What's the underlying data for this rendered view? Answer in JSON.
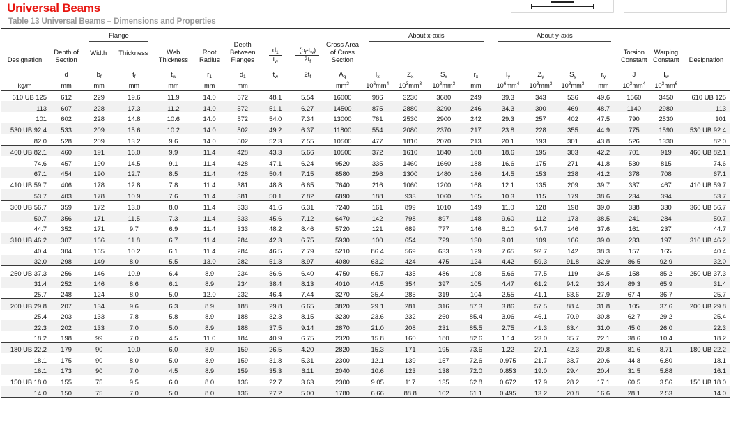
{
  "page": {
    "title": "Universal Beams",
    "caption": "Table 13 Universal Beams – Dimensions and Properties",
    "title_color": "#e8150f",
    "caption_color": "#9a9a9a"
  },
  "figures": [
    {
      "name": "beam-section-figure-1"
    },
    {
      "name": "beam-section-figure-2"
    }
  ],
  "header": {
    "groups": [
      {
        "label": "Flange",
        "span": 2
      },
      {
        "label": "About x-axis",
        "span": 4
      },
      {
        "label": "About y-axis",
        "span": 4
      }
    ],
    "columns": [
      {
        "title": "Designation",
        "symbol": "",
        "unit": "kg/m"
      },
      {
        "title": "Depth of Section",
        "symbol": "d",
        "unit": "mm"
      },
      {
        "title": "Width",
        "symbol": "b_f",
        "unit": "mm"
      },
      {
        "title": "Thickness",
        "symbol": "t_f",
        "unit": "mm"
      },
      {
        "title": "Web Thickness",
        "symbol": "t_w",
        "unit": "mm"
      },
      {
        "title": "Root Radius",
        "symbol": "r_1",
        "unit": "mm"
      },
      {
        "title": "Depth Between Flanges",
        "symbol": "d_1",
        "unit": "mm"
      },
      {
        "title": "d_1 / t_w",
        "symbol": "d1/tw",
        "unit": ""
      },
      {
        "title": "(b_f - t_w) / 2t_f",
        "symbol": "bf-tw/2tf",
        "unit": ""
      },
      {
        "title": "Gross Area of Cross Section",
        "symbol": "A_g",
        "unit": "mm2"
      },
      {
        "title": "",
        "symbol": "I_x",
        "unit": "10^6 mm^4"
      },
      {
        "title": "",
        "symbol": "Z_x",
        "unit": "10^3 mm^3"
      },
      {
        "title": "",
        "symbol": "S_x",
        "unit": "10^3 mm^3"
      },
      {
        "title": "",
        "symbol": "r_x",
        "unit": "mm"
      },
      {
        "title": "",
        "symbol": "I_y",
        "unit": "10^6 mm^4"
      },
      {
        "title": "",
        "symbol": "Z_y",
        "unit": "10^3 mm^3"
      },
      {
        "title": "",
        "symbol": "S_y",
        "unit": "10^3 mm^3"
      },
      {
        "title": "",
        "symbol": "r_y",
        "unit": "mm"
      },
      {
        "title": "Torsion Constant",
        "symbol": "J",
        "unit": "10^3 mm^4"
      },
      {
        "title": "Warping Constant",
        "symbol": "I_w",
        "unit": "10^3 mm^6"
      },
      {
        "title": "Designation",
        "symbol": "",
        "unit": ""
      }
    ],
    "labels": {
      "designation": "Designation",
      "depth_of_section": "Depth of Section",
      "flange": "Flange",
      "width": "Width",
      "thickness": "Thickness",
      "web_thickness": "Web Thickness",
      "root_radius": "Root Radius",
      "depth_between_flanges": "Depth Between Flanges",
      "gross_area": "Gross Area of Cross Section",
      "about_x": "About x-axis",
      "about_y": "About y-axis",
      "torsion_constant": "Torsion Constant",
      "warping_constant": "Warping Constant"
    }
  },
  "rows": [
    {
      "group": 1,
      "first": true,
      "alt": false,
      "c": [
        "610 UB 125",
        "612",
        "229",
        "19.6",
        "11.9",
        "14.0",
        "572",
        "48.1",
        "5.54",
        "16000",
        "986",
        "3230",
        "3680",
        "249",
        "39.3",
        "343",
        "536",
        "49.6",
        "1560",
        "3450",
        "610 UB 125"
      ]
    },
    {
      "group": 1,
      "first": false,
      "alt": true,
      "c": [
        "113",
        "607",
        "228",
        "17.3",
        "11.2",
        "14.0",
        "572",
        "51.1",
        "6.27",
        "14500",
        "875",
        "2880",
        "3290",
        "246",
        "34.3",
        "300",
        "469",
        "48.7",
        "1140",
        "2980",
        "113"
      ]
    },
    {
      "group": 1,
      "first": false,
      "alt": false,
      "c": [
        "101",
        "602",
        "228",
        "14.8",
        "10.6",
        "14.0",
        "572",
        "54.0",
        "7.34",
        "13000",
        "761",
        "2530",
        "2900",
        "242",
        "29.3",
        "257",
        "402",
        "47.5",
        "790",
        "2530",
        "101"
      ]
    },
    {
      "group": 2,
      "first": true,
      "alt": true,
      "c": [
        "530 UB 92.4",
        "533",
        "209",
        "15.6",
        "10.2",
        "14.0",
        "502",
        "49.2",
        "6.37",
        "11800",
        "554",
        "2080",
        "2370",
        "217",
        "23.8",
        "228",
        "355",
        "44.9",
        "775",
        "1590",
        "530 UB 92.4"
      ]
    },
    {
      "group": 2,
      "first": false,
      "alt": false,
      "c": [
        "82.0",
        "528",
        "209",
        "13.2",
        "9.6",
        "14.0",
        "502",
        "52.3",
        "7.55",
        "10500",
        "477",
        "1810",
        "2070",
        "213",
        "20.1",
        "193",
        "301",
        "43.8",
        "526",
        "1330",
        "82.0"
      ]
    },
    {
      "group": 3,
      "first": true,
      "alt": true,
      "c": [
        "460 UB 82.1",
        "460",
        "191",
        "16.0",
        "9.9",
        "11.4",
        "428",
        "43.3",
        "5.66",
        "10500",
        "372",
        "1610",
        "1840",
        "188",
        "18.6",
        "195",
        "303",
        "42.2",
        "701",
        "919",
        "460 UB 82.1"
      ]
    },
    {
      "group": 3,
      "first": false,
      "alt": false,
      "c": [
        "74.6",
        "457",
        "190",
        "14.5",
        "9.1",
        "11.4",
        "428",
        "47.1",
        "6.24",
        "9520",
        "335",
        "1460",
        "1660",
        "188",
        "16.6",
        "175",
        "271",
        "41.8",
        "530",
        "815",
        "74.6"
      ]
    },
    {
      "group": 3,
      "first": false,
      "alt": true,
      "c": [
        "67.1",
        "454",
        "190",
        "12.7",
        "8.5",
        "11.4",
        "428",
        "50.4",
        "7.15",
        "8580",
        "296",
        "1300",
        "1480",
        "186",
        "14.5",
        "153",
        "238",
        "41.2",
        "378",
        "708",
        "67.1"
      ]
    },
    {
      "group": 4,
      "first": true,
      "alt": false,
      "c": [
        "410 UB 59.7",
        "406",
        "178",
        "12.8",
        "7.8",
        "11.4",
        "381",
        "48.8",
        "6.65",
        "7640",
        "216",
        "1060",
        "1200",
        "168",
        "12.1",
        "135",
        "209",
        "39.7",
        "337",
        "467",
        "410 UB 59.7"
      ]
    },
    {
      "group": 4,
      "first": false,
      "alt": true,
      "c": [
        "53.7",
        "403",
        "178",
        "10.9",
        "7.6",
        "11.4",
        "381",
        "50.1",
        "7.82",
        "6890",
        "188",
        "933",
        "1060",
        "165",
        "10.3",
        "115",
        "179",
        "38.6",
        "234",
        "394",
        "53.7"
      ]
    },
    {
      "group": 5,
      "first": true,
      "alt": false,
      "c": [
        "360 UB 56.7",
        "359",
        "172",
        "13.0",
        "8.0",
        "11.4",
        "333",
        "41.6",
        "6.31",
        "7240",
        "161",
        "899",
        "1010",
        "149",
        "11.0",
        "128",
        "198",
        "39.0",
        "338",
        "330",
        "360 UB 56.7"
      ]
    },
    {
      "group": 5,
      "first": false,
      "alt": true,
      "c": [
        "50.7",
        "356",
        "171",
        "11.5",
        "7.3",
        "11.4",
        "333",
        "45.6",
        "7.12",
        "6470",
        "142",
        "798",
        "897",
        "148",
        "9.60",
        "112",
        "173",
        "38.5",
        "241",
        "284",
        "50.7"
      ]
    },
    {
      "group": 5,
      "first": false,
      "alt": false,
      "c": [
        "44.7",
        "352",
        "171",
        "9.7",
        "6.9",
        "11.4",
        "333",
        "48.2",
        "8.46",
        "5720",
        "121",
        "689",
        "777",
        "146",
        "8.10",
        "94.7",
        "146",
        "37.6",
        "161",
        "237",
        "44.7"
      ]
    },
    {
      "group": 6,
      "first": true,
      "alt": true,
      "c": [
        "310 UB 46.2",
        "307",
        "166",
        "11.8",
        "6.7",
        "11.4",
        "284",
        "42.3",
        "6.75",
        "5930",
        "100",
        "654",
        "729",
        "130",
        "9.01",
        "109",
        "166",
        "39.0",
        "233",
        "197",
        "310 UB 46.2"
      ]
    },
    {
      "group": 6,
      "first": false,
      "alt": false,
      "c": [
        "40.4",
        "304",
        "165",
        "10.2",
        "6.1",
        "11.4",
        "284",
        "46.5",
        "7.79",
        "5210",
        "86.4",
        "569",
        "633",
        "129",
        "7.65",
        "92.7",
        "142",
        "38.3",
        "157",
        "165",
        "40.4"
      ]
    },
    {
      "group": 6,
      "first": false,
      "alt": true,
      "c": [
        "32.0",
        "298",
        "149",
        "8.0",
        "5.5",
        "13.0",
        "282",
        "51.3",
        "8.97",
        "4080",
        "63.2",
        "424",
        "475",
        "124",
        "4.42",
        "59.3",
        "91.8",
        "32.9",
        "86.5",
        "92.9",
        "32.0"
      ]
    },
    {
      "group": 7,
      "first": true,
      "alt": false,
      "c": [
        "250 UB 37.3",
        "256",
        "146",
        "10.9",
        "6.4",
        "8.9",
        "234",
        "36.6",
        "6.40",
        "4750",
        "55.7",
        "435",
        "486",
        "108",
        "5.66",
        "77.5",
        "119",
        "34.5",
        "158",
        "85.2",
        "250 UB 37.3"
      ]
    },
    {
      "group": 7,
      "first": false,
      "alt": true,
      "c": [
        "31.4",
        "252",
        "146",
        "8.6",
        "6.1",
        "8.9",
        "234",
        "38.4",
        "8.13",
        "4010",
        "44.5",
        "354",
        "397",
        "105",
        "4.47",
        "61.2",
        "94.2",
        "33.4",
        "89.3",
        "65.9",
        "31.4"
      ]
    },
    {
      "group": 7,
      "first": false,
      "alt": false,
      "c": [
        "25.7",
        "248",
        "124",
        "8.0",
        "5.0",
        "12.0",
        "232",
        "46.4",
        "7.44",
        "3270",
        "35.4",
        "285",
        "319",
        "104",
        "2.55",
        "41.1",
        "63.6",
        "27.9",
        "67.4",
        "36.7",
        "25.7"
      ]
    },
    {
      "group": 8,
      "first": true,
      "alt": true,
      "c": [
        "200 UB 29.8",
        "207",
        "134",
        "9.6",
        "6.3",
        "8.9",
        "188",
        "29.8",
        "6.65",
        "3820",
        "29.1",
        "281",
        "316",
        "87.3",
        "3.86",
        "57.5",
        "88.4",
        "31.8",
        "105",
        "37.6",
        "200 UB 29.8"
      ]
    },
    {
      "group": 8,
      "first": false,
      "alt": false,
      "c": [
        "25.4",
        "203",
        "133",
        "7.8",
        "5.8",
        "8.9",
        "188",
        "32.3",
        "8.15",
        "3230",
        "23.6",
        "232",
        "260",
        "85.4",
        "3.06",
        "46.1",
        "70.9",
        "30.8",
        "62.7",
        "29.2",
        "25.4"
      ]
    },
    {
      "group": 8,
      "first": false,
      "alt": true,
      "c": [
        "22.3",
        "202",
        "133",
        "7.0",
        "5.0",
        "8.9",
        "188",
        "37.5",
        "9.14",
        "2870",
        "21.0",
        "208",
        "231",
        "85.5",
        "2.75",
        "41.3",
        "63.4",
        "31.0",
        "45.0",
        "26.0",
        "22.3"
      ]
    },
    {
      "group": 8,
      "first": false,
      "alt": false,
      "c": [
        "18.2",
        "198",
        "99",
        "7.0",
        "4.5",
        "11.0",
        "184",
        "40.9",
        "6.75",
        "2320",
        "15.8",
        "160",
        "180",
        "82.6",
        "1.14",
        "23.0",
        "35.7",
        "22.1",
        "38.6",
        "10.4",
        "18.2"
      ]
    },
    {
      "group": 9,
      "first": true,
      "alt": true,
      "c": [
        "180 UB 22.2",
        "179",
        "90",
        "10.0",
        "6.0",
        "8.9",
        "159",
        "26.5",
        "4.20",
        "2820",
        "15.3",
        "171",
        "195",
        "73.6",
        "1.22",
        "27.1",
        "42.3",
        "20.8",
        "81.6",
        "8.71",
        "180 UB 22.2"
      ]
    },
    {
      "group": 9,
      "first": false,
      "alt": false,
      "c": [
        "18.1",
        "175",
        "90",
        "8.0",
        "5.0",
        "8.9",
        "159",
        "31.8",
        "5.31",
        "2300",
        "12.1",
        "139",
        "157",
        "72.6",
        "0.975",
        "21.7",
        "33.7",
        "20.6",
        "44.8",
        "6.80",
        "18.1"
      ]
    },
    {
      "group": 9,
      "first": false,
      "alt": true,
      "c": [
        "16.1",
        "173",
        "90",
        "7.0",
        "4.5",
        "8.9",
        "159",
        "35.3",
        "6.11",
        "2040",
        "10.6",
        "123",
        "138",
        "72.0",
        "0.853",
        "19.0",
        "29.4",
        "20.4",
        "31.5",
        "5.88",
        "16.1"
      ]
    },
    {
      "group": 10,
      "first": true,
      "alt": false,
      "c": [
        "150 UB 18.0",
        "155",
        "75",
        "9.5",
        "6.0",
        "8.0",
        "136",
        "22.7",
        "3.63",
        "2300",
        "9.05",
        "117",
        "135",
        "62.8",
        "0.672",
        "17.9",
        "28.2",
        "17.1",
        "60.5",
        "3.56",
        "150 UB 18.0"
      ]
    },
    {
      "group": 10,
      "first": false,
      "alt": true,
      "last": true,
      "c": [
        "14.0",
        "150",
        "75",
        "7.0",
        "5.0",
        "8.0",
        "136",
        "27.2",
        "5.00",
        "1780",
        "6.66",
        "88.8",
        "102",
        "61.1",
        "0.495",
        "13.2",
        "20.8",
        "16.6",
        "28.1",
        "2.53",
        "14.0"
      ]
    }
  ]
}
